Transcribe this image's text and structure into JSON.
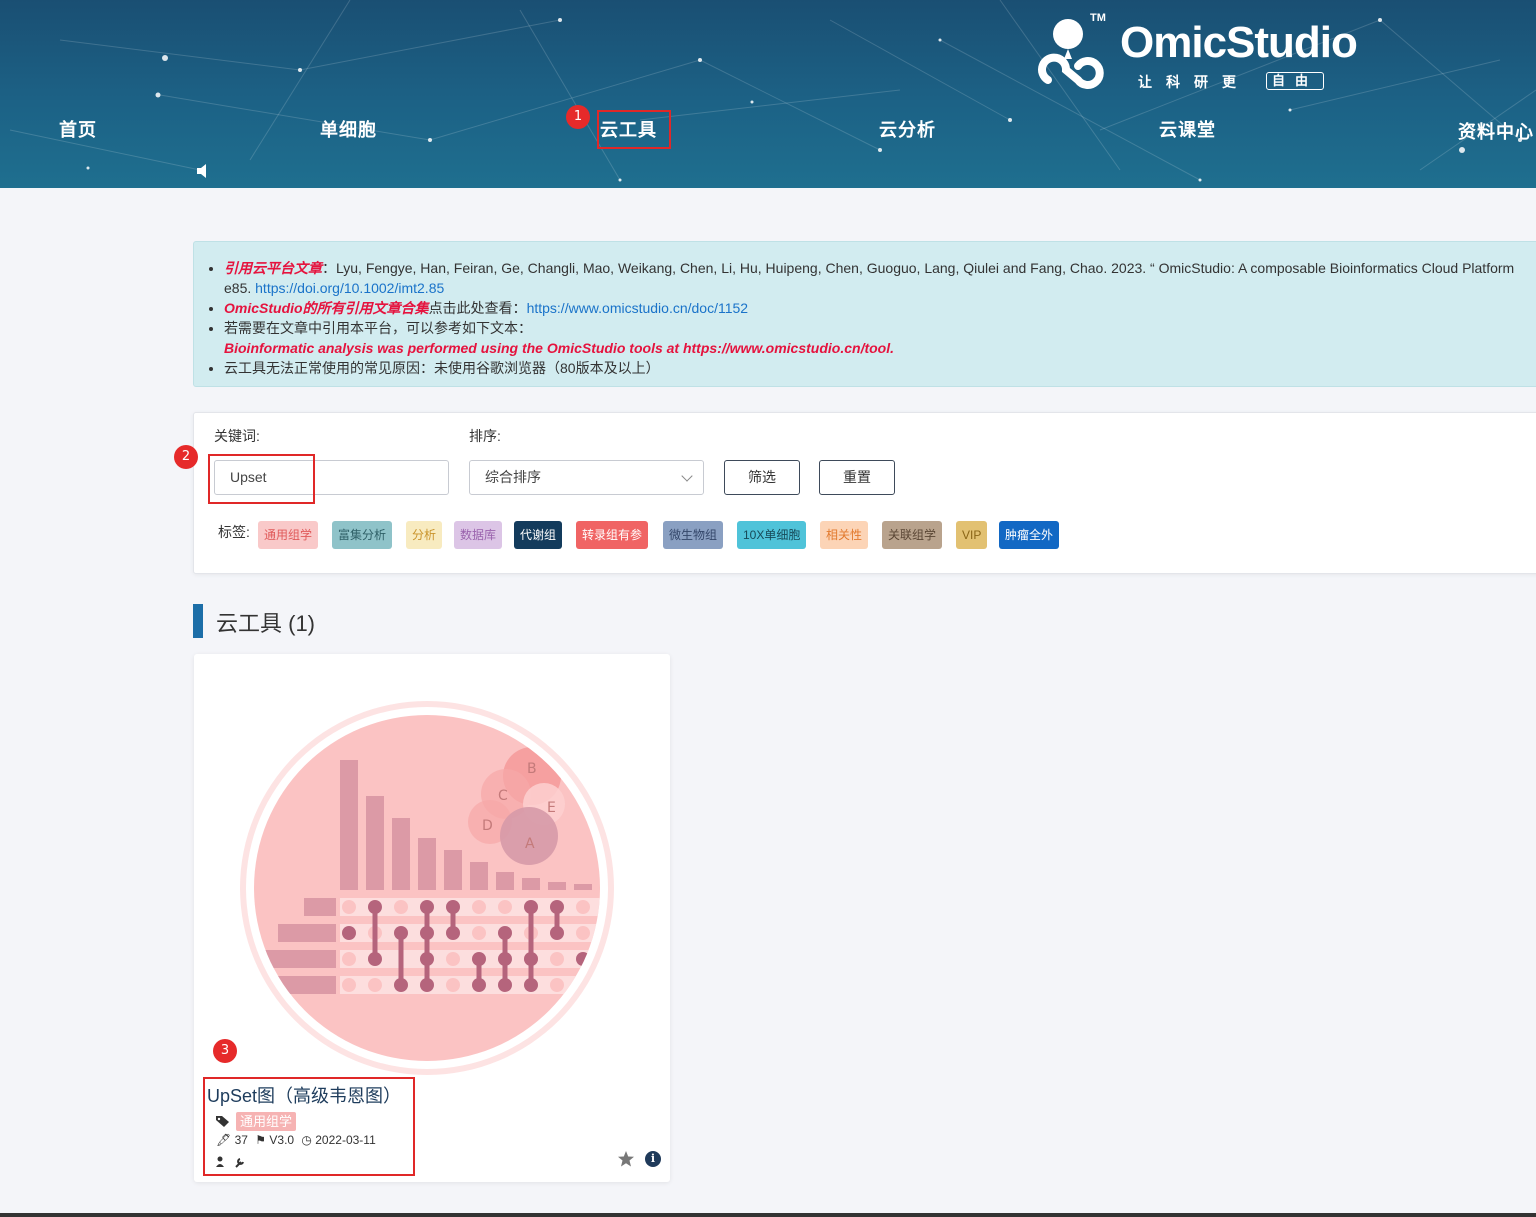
{
  "brand": {
    "name": "OmicStudio",
    "tm": "TM",
    "slogan": "让科研更",
    "slogan_box": "自由"
  },
  "nav": {
    "items": [
      {
        "label": "首页"
      },
      {
        "label": "单细胞"
      },
      {
        "label": "云工具"
      },
      {
        "label": "云分析"
      },
      {
        "label": "云课堂"
      },
      {
        "label": "资料中心"
      }
    ]
  },
  "annotations": {
    "step1": "1",
    "step2": "2",
    "step3": "3"
  },
  "notice": {
    "cite_label": "引用云平台文章",
    "cite_text": "：Lyu, Fengye, Han, Feiran, Ge, Changli, Mao, Weikang, Chen, Li, Hu, Huipeng, Chen, Guoguo, Lang, Qiulei and Fang, Chao. 2023. “ OmicStudio: A composable Bioinformatics Cloud Platform",
    "cite_text_2": "e85. ",
    "cite_doi": "https://doi.org/10.1002/imt2.85",
    "collection_label": "OmicStudio的所有引用文章合集",
    "collection_text": "点击此处查看：",
    "collection_link": "https://www.omicstudio.cn/doc/1152",
    "howto_text": "若需要在文章中引用本平台，可以参考如下文本：",
    "howto_quote": "Bioinformatic analysis was performed using the OmicStudio tools at https://www.omicstudio.cn/tool.",
    "issue_text": "云工具无法正常使用的常见原因：未使用谷歌浏览器（80版本及以上）"
  },
  "filter": {
    "keyword_label": "关键词:",
    "keyword_value": "Upset",
    "sort_label": "排序:",
    "sort_value": "综合排序",
    "filter_button": "筛选",
    "reset_button": "重置",
    "tags_label": "标签:",
    "tags": [
      {
        "label": "通用组学",
        "bg": "#f9c9c9",
        "fg": "#e05a5a"
      },
      {
        "label": "富集分析",
        "bg": "#8fc3c9",
        "fg": "#2e5f66"
      },
      {
        "label": "分析",
        "bg": "#f8ebc0",
        "fg": "#c9932b"
      },
      {
        "label": "数据库",
        "bg": "#dcc5e6",
        "fg": "#9a63ad"
      },
      {
        "label": "代谢组",
        "bg": "#133b5c",
        "fg": "#ffffff"
      },
      {
        "label": "转录组有参",
        "bg": "#f06464",
        "fg": "#ffffff"
      },
      {
        "label": "微生物组",
        "bg": "#8aa0c2",
        "fg": "#34476a"
      },
      {
        "label": "10X单细胞",
        "bg": "#4fc3d9",
        "fg": "#174a58"
      },
      {
        "label": "相关性",
        "bg": "#fcd4b6",
        "fg": "#e27a2e"
      },
      {
        "label": "关联组学",
        "bg": "#b9a38d",
        "fg": "#5a4634"
      },
      {
        "label": "VIP",
        "bg": "#e2c172",
        "fg": "#8a6516"
      },
      {
        "label": "肿瘤全外",
        "bg": "#1268c4",
        "fg": "#ffffff"
      }
    ]
  },
  "section": {
    "title": "云工具 (1)"
  },
  "tools": [
    {
      "title": "UpSet图（高级韦恩图）",
      "tag": "通用组学",
      "uses": "37",
      "version": "V3.0",
      "date": "2022-03-11",
      "venn_labels": [
        "A",
        "B",
        "C",
        "D",
        "E"
      ]
    }
  ],
  "colors": {
    "accent": "#1c6ea8",
    "header": "#1c5a80",
    "annotation_red": "#e02828"
  }
}
